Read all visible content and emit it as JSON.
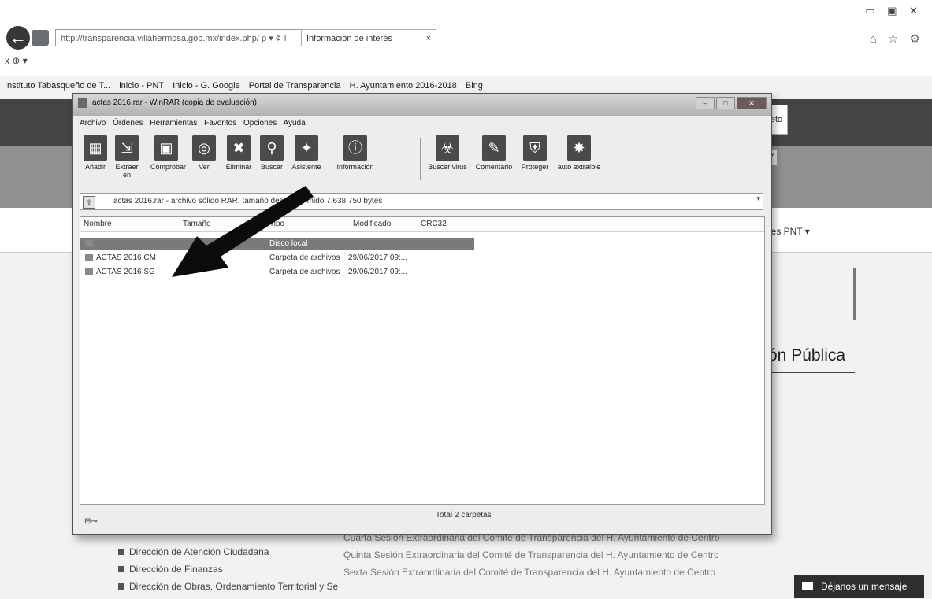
{
  "browser": {
    "address": "http://transparencia.villahermosa.gob.mx/index.php/",
    "address_suffix": "ρ ▾ ¢ ‖",
    "tab_title": "Información de interés",
    "tab_close": "×",
    "window_controls": "▭ ▣ ✕",
    "toolbar_icons": "⌂ ☆ ⚙",
    "cmdbar": "x ⊕ ▾",
    "favorites": [
      "Instituto Tabasqueño de T...",
      "inicio - PNT",
      "Inicio - G. Google",
      "Portal de Transparencia",
      "H. Ayuntamiento 2016-2018",
      "Bing"
    ]
  },
  "site": {
    "contact": "feto",
    "banner_num": "7",
    "nav_item": "des PNT ▾",
    "section_title": "ón Pública",
    "left_links": [
      "Dirección de Atención Ciudadana",
      "Dirección de Finanzas",
      "Dirección de Obras, Ordenamiento Territorial y Se"
    ],
    "mid_links": [
      "Cuarta Sesión Extraordinaria del Comité de Transparencia del H. Ayuntamiento de Centro",
      "Quinta Sesión Extraordinaria del Comité de Transparencia del H. Ayuntamiento de Centro",
      "Sexta Sesión Extraordinaria del Comité de Transparencia del H. Ayuntamiento de Centro"
    ],
    "message_button": "Déjanos un mensaje"
  },
  "winrar": {
    "title": "actas 2016.rar - WinRAR (copia de evaluación)",
    "menu": [
      "Archivo",
      "Órdenes",
      "Herramientas",
      "Favoritos",
      "Opciones",
      "Ayuda"
    ],
    "toolbar": [
      {
        "label": "Añadir",
        "icon": "▦"
      },
      {
        "label": "Extraer en",
        "icon": "⇲"
      },
      {
        "label": "Comprobar",
        "icon": "▣"
      },
      {
        "label": "Ver",
        "icon": "◎"
      },
      {
        "label": "Eliminar",
        "icon": "✖"
      },
      {
        "label": "Buscar",
        "icon": "⚲"
      },
      {
        "label": "Asistente",
        "icon": "✦"
      },
      {
        "label": "Información",
        "icon": "ⓘ"
      },
      {
        "label": "Buscar virus",
        "icon": "☣"
      },
      {
        "label": "Comentario",
        "icon": "✎"
      },
      {
        "label": "Proteger",
        "icon": "⛨"
      },
      {
        "label": "auto extraíble",
        "icon": "✸"
      }
    ],
    "path": "actas 2016.rar - archivo sólido RAR, tamaño descomprimido 7.638.750 bytes",
    "columns": [
      "Nombre",
      "Tamaño",
      "Tipo",
      "Modificado",
      "CRC32"
    ],
    "parent_row_type": "Disco local",
    "rows": [
      {
        "name": "ACTAS 2016 CM",
        "type": "Carpeta de archivos",
        "modified": "29/06/2017 09:..."
      },
      {
        "name": "ACTAS 2016 SG",
        "type": "Carpeta de archivos",
        "modified": "29/06/2017 09:..."
      }
    ],
    "status": "Total 2 carpetas",
    "status_icon": "⊟⊸"
  }
}
